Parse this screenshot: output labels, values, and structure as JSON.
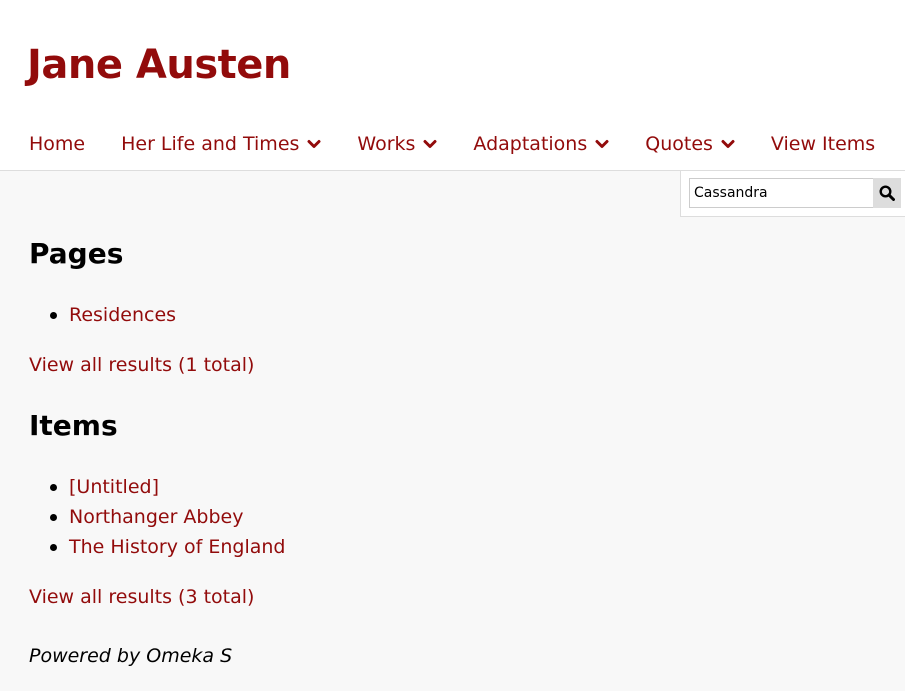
{
  "site": {
    "title": "Jane Austen",
    "accent_color": "#920b0b"
  },
  "nav": {
    "items": [
      {
        "label": "Home",
        "has_dropdown": false
      },
      {
        "label": "Her Life and Times",
        "has_dropdown": true
      },
      {
        "label": "Works",
        "has_dropdown": true
      },
      {
        "label": "Adaptations",
        "has_dropdown": true
      },
      {
        "label": "Quotes",
        "has_dropdown": true
      },
      {
        "label": "View Items",
        "has_dropdown": false
      }
    ]
  },
  "search": {
    "value": "Cassandra",
    "icon": "search-icon"
  },
  "results": {
    "pages": {
      "heading": "Pages",
      "items": [
        "Residences"
      ],
      "view_all": "View all results (1 total)"
    },
    "items": {
      "heading": "Items",
      "items": [
        "[Untitled]",
        "Northanger Abbey",
        "The History of England"
      ],
      "view_all": "View all results (3 total)"
    }
  },
  "footer": {
    "powered_by": "Powered by Omeka S"
  }
}
